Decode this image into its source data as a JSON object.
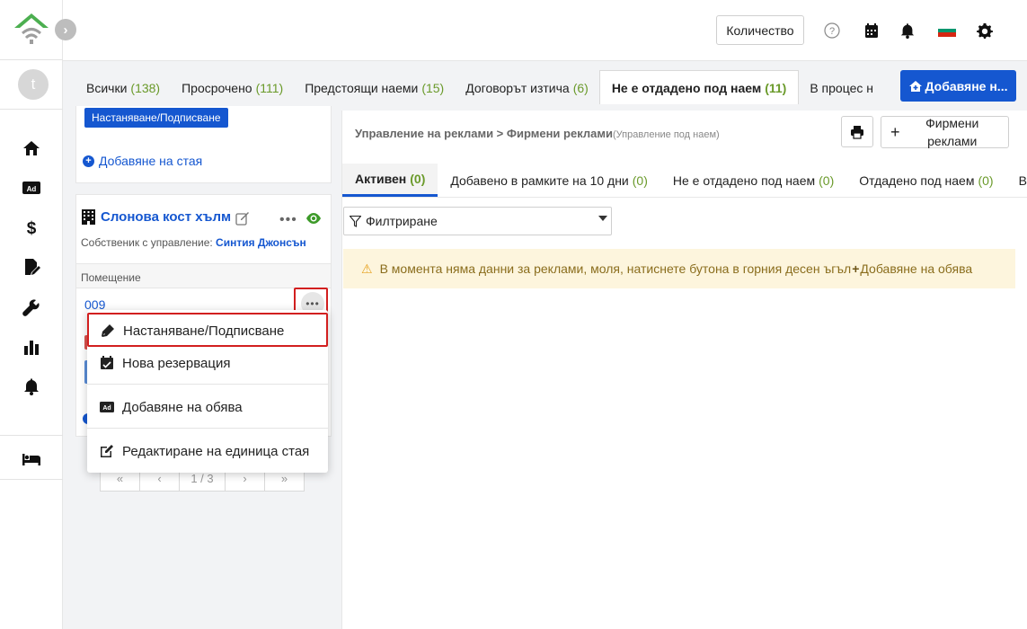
{
  "app": {
    "avatar_letter": "t",
    "expand_glyph": "›"
  },
  "topbar": {
    "qty_label": "Количество",
    "icons": [
      "help-icon",
      "calendar-icon",
      "bell-icon",
      "flag-bg-icon",
      "gear-icon"
    ],
    "flag_colors": [
      "#ffffff",
      "#00966e",
      "#d62612"
    ]
  },
  "sidebar": {
    "items": [
      "home-icon",
      "ad-icon",
      "dollar-icon",
      "contract-icon",
      "wrench-icon",
      "chart-icon",
      "bell-icon",
      "bed-icon"
    ]
  },
  "tabs": [
    {
      "label": "Всички",
      "count": "(138)"
    },
    {
      "label": "Просрочено",
      "count": "(111)"
    },
    {
      "label": "Предстоящи наеми",
      "count": "(15)"
    },
    {
      "label": "Договорът изтича",
      "count": "(6)"
    },
    {
      "label": "Не е отдадено под наем",
      "count": "(11)"
    },
    {
      "label": "В процес н",
      "count": ""
    }
  ],
  "add_button_label": "Добавяне н...",
  "left": {
    "checkin_chip": "Настаняване/Подписване",
    "add_room": "Добавяне на стая",
    "property_name": "Слонова кост хълм",
    "owner_prefix": "Собственик с управление:",
    "owner_name": "Синтия Джонсън",
    "room_header": "Помещение",
    "room_number": "009",
    "pager": [
      "«",
      "‹",
      "1 / 3",
      "›",
      "»"
    ]
  },
  "menu": {
    "items": [
      {
        "label": "Настаняване/Подписване",
        "icon": "pen-icon"
      },
      {
        "label": "Нова резервация",
        "icon": "calendar-check-icon"
      },
      {
        "label": "Добавяне на обява",
        "icon": "ad-icon"
      },
      {
        "label": "Редактиране на единица стая",
        "icon": "edit-icon"
      }
    ]
  },
  "content": {
    "breadcrumb_main": "Управление на реклами > Фирмени реклами",
    "breadcrumb_sub": "(Управление под наем)",
    "brand_ads_label": "Фирмени реклами",
    "subtabs": [
      {
        "label": "Активен",
        "count": "(0)"
      },
      {
        "label": "Добавено в рамките на 10 дни",
        "count": "(0)"
      },
      {
        "label": "Не е отдадено под наем",
        "count": "(0)"
      },
      {
        "label": "Отдадено под наем",
        "count": "(0)"
      },
      {
        "label": "В",
        "count": ""
      }
    ],
    "filter_label": "Филтриране",
    "warning_text": "В момента няма данни за реклами, моля, натиснете бутона в горния десен ъгъл",
    "warning_link": "Добавяне на обява"
  }
}
